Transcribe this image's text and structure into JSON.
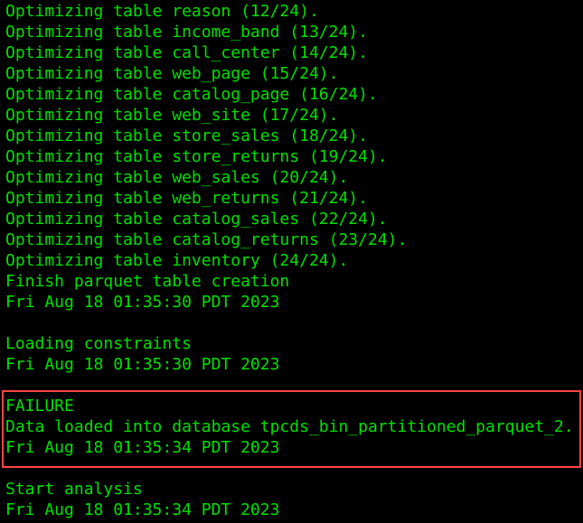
{
  "colors": {
    "text": "#00e000",
    "highlight_border": "#ff4444",
    "background": "#000000"
  },
  "lines": [
    "Optimizing table reason (12/24).",
    "Optimizing table income_band (13/24).",
    "Optimizing table call_center (14/24).",
    "Optimizing table web_page (15/24).",
    "Optimizing table catalog_page (16/24).",
    "Optimizing table web_site (17/24).",
    "Optimizing table store_sales (18/24).",
    "Optimizing table store_returns (19/24).",
    "Optimizing table web_sales (20/24).",
    "Optimizing table web_returns (21/24).",
    "Optimizing table catalog_sales (22/24).",
    "Optimizing table catalog_returns (23/24).",
    "Optimizing table inventory (24/24).",
    "Finish parquet table creation",
    "Fri Aug 18 01:35:30 PDT 2023",
    "",
    "Loading constraints",
    "Fri Aug 18 01:35:30 PDT 2023",
    "",
    "FAILURE",
    "Data loaded into database tpcds_bin_partitioned_parquet_2.",
    "Fri Aug 18 01:35:34 PDT 2023",
    "",
    "Start analysis",
    "Fri Aug 18 01:35:34 PDT 2023"
  ]
}
